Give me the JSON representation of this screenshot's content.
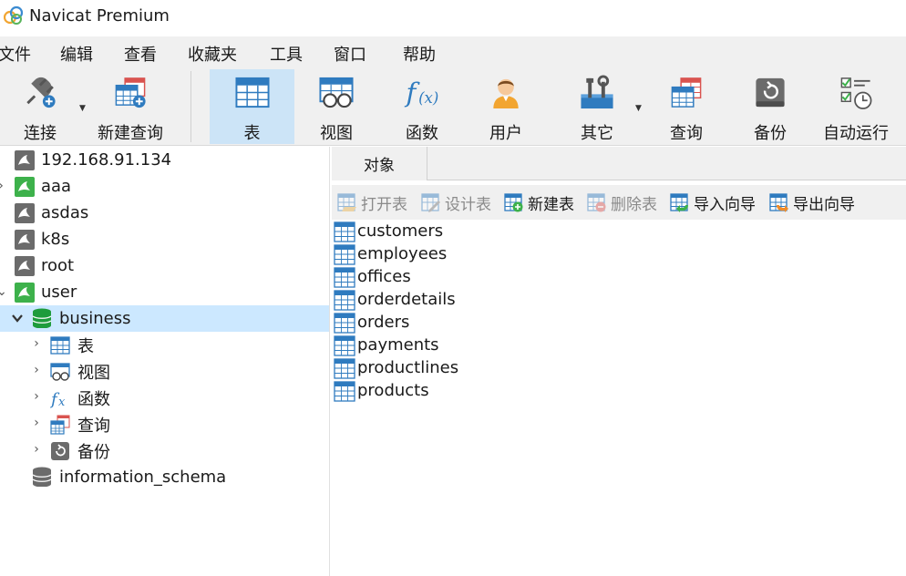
{
  "window": {
    "title": "Navicat Premium"
  },
  "menu": {
    "items": [
      "文件",
      "编辑",
      "查看",
      "收藏夹",
      "工具",
      "窗口",
      "帮助"
    ]
  },
  "toolbar": {
    "buttons": [
      {
        "label": "连接",
        "icon": "connection-plug-icon"
      },
      {
        "label": "新建查询",
        "icon": "new-query-icon"
      },
      {
        "label": "表",
        "icon": "table-icon"
      },
      {
        "label": "视图",
        "icon": "view-glasses-icon"
      },
      {
        "label": "函数",
        "icon": "function-fx-icon"
      },
      {
        "label": "用户",
        "icon": "user-icon"
      },
      {
        "label": "其它",
        "icon": "tools-icon"
      },
      {
        "label": "查询",
        "icon": "query-icon"
      },
      {
        "label": "备份",
        "icon": "backup-icon"
      },
      {
        "label": "自动运行",
        "icon": "auto-run-icon"
      }
    ],
    "active": "表"
  },
  "nav": {
    "connections": [
      {
        "label": "192.168.91.134",
        "status": "disconnected"
      },
      {
        "label": "aaa",
        "status": "connected"
      },
      {
        "label": "asdas",
        "status": "disconnected"
      },
      {
        "label": "k8s",
        "status": "disconnected"
      },
      {
        "label": "root",
        "status": "disconnected"
      },
      {
        "label": "user",
        "status": "connected"
      }
    ],
    "database_open": "business",
    "database_children": [
      "表",
      "视图",
      "函数",
      "查询",
      "备份"
    ],
    "database_closed": "information_schema"
  },
  "right": {
    "tab_label": "对象",
    "object_toolbar": [
      {
        "label": "打开表",
        "enabled": false
      },
      {
        "label": "设计表",
        "enabled": false
      },
      {
        "label": "新建表",
        "enabled": true
      },
      {
        "label": "删除表",
        "enabled": false
      },
      {
        "label": "导入向导",
        "enabled": true
      },
      {
        "label": "导出向导",
        "enabled": true
      }
    ],
    "tables": [
      "customers",
      "employees",
      "offices",
      "orderdetails",
      "orders",
      "payments",
      "productlines",
      "products"
    ]
  },
  "colors": {
    "accent_blue": "#2f7bbf",
    "toolbar_bg": "#f0f0f0",
    "selected_row": "#cce8ff",
    "active_toolbar": "#cce4f7",
    "connected_green": "#3db14b",
    "disconnected_gray": "#6b6b6b",
    "db_green": "#1e9c3c"
  }
}
